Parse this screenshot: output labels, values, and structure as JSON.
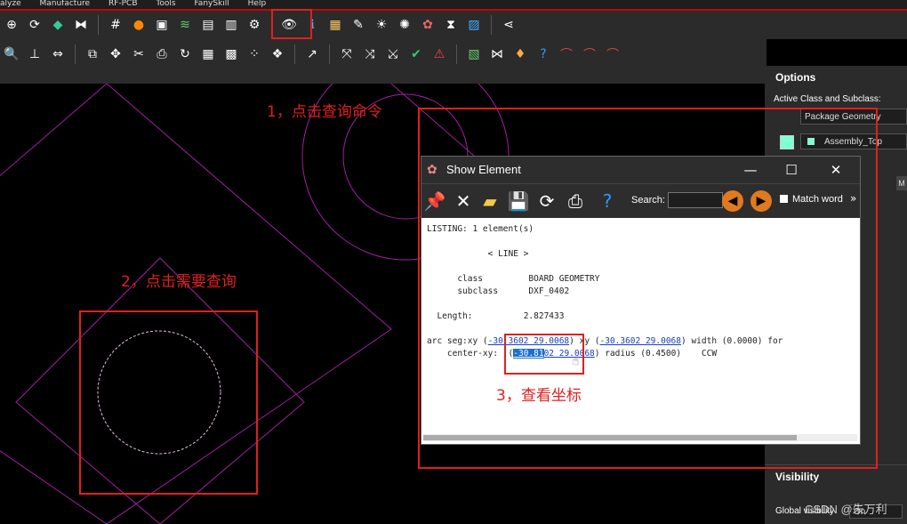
{
  "menubar": {
    "items": [
      "alyze",
      "Manufacture",
      "RF-PCB",
      "Tools",
      "FanySkill",
      "Help"
    ]
  },
  "colors": {
    "accent_red": "#e0201e",
    "canvas_bg": "#000000",
    "geometry_purple": "#b020b0",
    "subclass_color": "#7fffd4"
  },
  "toolbar_icons": {
    "row1": [
      "zoom-fit-icon",
      "refresh-icon",
      "board-icon",
      "flip-icon",
      "grid-icon",
      "color-icon",
      "layers-icon",
      "stack-icon",
      "document-icon",
      "report-icon",
      "settings-icon",
      "show-element-eye-icon",
      "info-icon",
      "measure-icon",
      "palette-icon",
      "highlight-icon",
      "dehighlight-icon",
      "assign-color-icon",
      "hourglass-icon",
      "image-icon",
      "share-icon"
    ],
    "row2": [
      "zoom-icon",
      "dimension-icon",
      "ruler-icon",
      "copy-icon",
      "move-icon",
      "delete-icon",
      "print-icon",
      "rotate-icon",
      "table-icon",
      "text-icon",
      "pattern-a-icon",
      "pattern-b-icon",
      "route-icon",
      "tool-a-icon",
      "tool-b-icon",
      "tool-c-icon",
      "tool-d-icon",
      "tool-e-icon",
      "chart-icon",
      "mirror-icon",
      "pin-icon",
      "help-icon",
      "add-net-icon",
      "edit-net-icon",
      "del-net-icon"
    ]
  },
  "options_panel": {
    "title": "Options",
    "active_label": "Active Class and Subclass:",
    "class_value": "Package Geometry",
    "subclass_value": "Assembly_Top",
    "side_button": "M",
    "visibility_title": "Visibility",
    "global_visibility_label": "Global visibility",
    "global_visibility_value": "On"
  },
  "dialog": {
    "title": "Show Element",
    "search_label": "Search:",
    "search_value": "",
    "match_word_label": "Match word",
    "more_glyph": "»",
    "minimize": "—",
    "maximize": "☐",
    "close": "✕",
    "listing": {
      "header": "LISTING: 1 element(s)",
      "type": "< LINE >",
      "class_key": "class",
      "class_value": "BOARD GEOMETRY",
      "subclass_key": "subclass",
      "subclass_value": "DXF_0402",
      "length_key": "Length:",
      "length_value": "2.827433",
      "arc_prefix": "arc seg:xy (",
      "arc_xy1": "-30.3602 29.0068",
      "arc_mid": ") xy (",
      "arc_xy2": "-30.3602 29.0068",
      "arc_suffix": ") width (0.0000) for",
      "center_prefix": "center-xy:  (",
      "center_sel": "-30.81",
      "center_rest": "02 29.0068",
      "center_suffix": ") radius (0.4500)    CCW"
    }
  },
  "annotations": {
    "step1": "1，点击查询命令",
    "step2": "2，点击需要查询",
    "step3": "3，查看坐标"
  },
  "watermark": "CSDN @朱万利"
}
